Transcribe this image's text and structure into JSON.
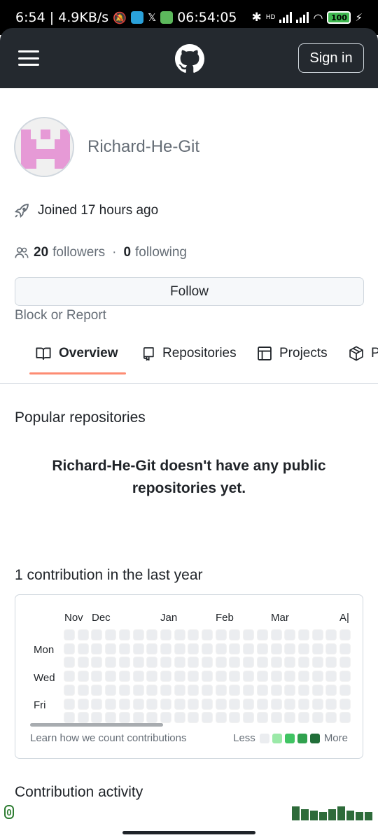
{
  "status_bar": {
    "left_text": "6:54 | 4.9KB/s",
    "clock": "06:54:05",
    "network_label": "HD",
    "battery": "100"
  },
  "header": {
    "sign_in_label": "Sign in"
  },
  "profile": {
    "username": "Richard-He-Git",
    "joined": "Joined 17 hours ago",
    "followers_count": "20",
    "followers_label": "followers",
    "separator": "·",
    "following_count": "0",
    "following_label": "following",
    "follow_label": "Follow",
    "block_report_label": "Block or Report"
  },
  "tabs": [
    {
      "label": "Overview",
      "icon": "book-icon",
      "active": true
    },
    {
      "label": "Repositories",
      "icon": "repo-icon",
      "active": false
    },
    {
      "label": "Projects",
      "icon": "table-icon",
      "active": false
    },
    {
      "label": "P",
      "icon": "package-icon",
      "active": false
    }
  ],
  "popular": {
    "title": "Popular repositories",
    "empty_message": "Richard-He-Git doesn't have any public repositories yet."
  },
  "contributions": {
    "title": "1 contribution in the last year",
    "months": [
      "Nov",
      "Dec",
      "Jan",
      "Feb",
      "Mar",
      "A|"
    ],
    "days": [
      "Mon",
      "Wed",
      "Fri"
    ],
    "learn_label": "Learn how we count contributions",
    "less_label": "Less",
    "more_label": "More",
    "legend_colors": [
      "#ebedf0",
      "#9be9a8",
      "#40c463",
      "#30a14e",
      "#216e39"
    ]
  },
  "activity": {
    "title": "Contribution activity"
  },
  "overlay": {
    "left_badge": "0"
  },
  "colors": {
    "header_bg": "#24292f",
    "tab_underline": "#fd8c73",
    "avatar_pink": "#e69ad6"
  }
}
